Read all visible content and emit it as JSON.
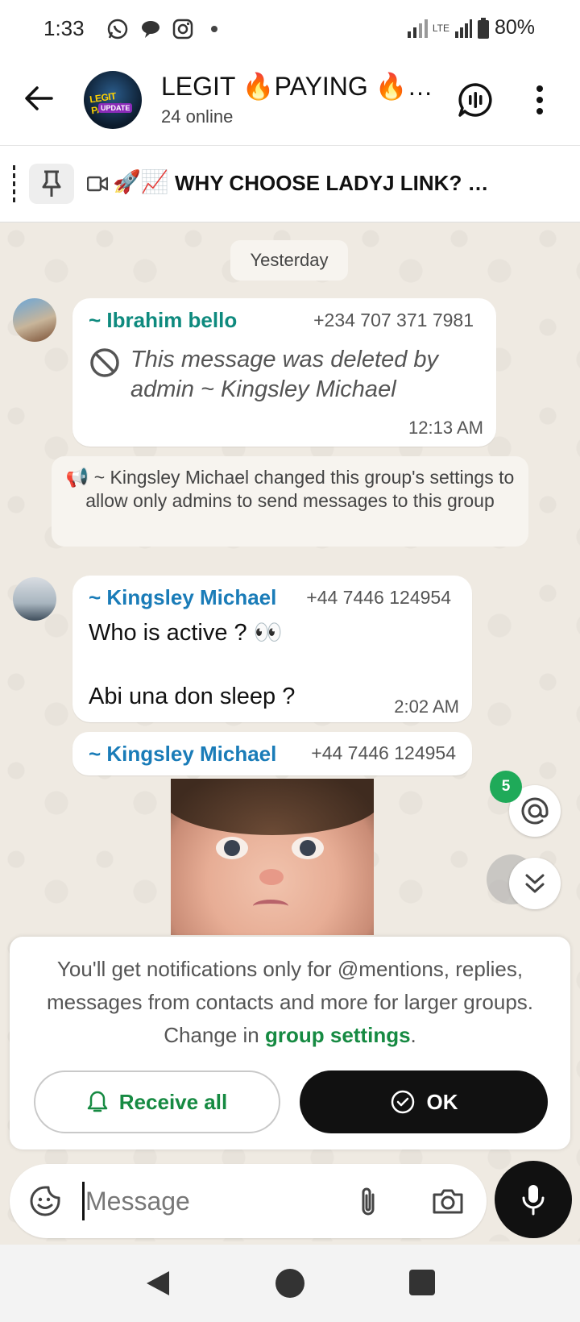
{
  "status_bar": {
    "time": "1:33",
    "network": "LTE",
    "battery": "80%",
    "notification_icons": [
      "whatsapp-icon",
      "chat-bubble-icon",
      "instagram-icon"
    ]
  },
  "header": {
    "avatar_text_1": "LEGIT PAYING",
    "avatar_text_2": "UPDATE",
    "title": "LEGIT 🔥PAYING 🔥…",
    "subtitle": "24 online"
  },
  "pinned": {
    "emoji": "🚀📈",
    "text": "WHY CHOOSE LADYJ LINK? …"
  },
  "chat": {
    "date_chip": "Yesterday",
    "messages": [
      {
        "sender": "~ Ibrahim bello",
        "phone": "+234 707 371 7981",
        "text": "This message was deleted by admin ~ Kingsley Michael",
        "time": "12:13 AM",
        "sender_color": "#0e8a7e"
      },
      {
        "type": "system",
        "text": "📢 ~ Kingsley Michael changed this group's settings to allow only admins to send messages to this group"
      },
      {
        "sender": "~ Kingsley Michael",
        "phone": "+44 7446 124954",
        "line1": "Who is active ? 👀",
        "line2": "Abi una don sleep ?",
        "time": "2:02 AM",
        "sender_color": "#1a7cb8"
      },
      {
        "sender": "~ Kingsley Michael",
        "phone": "+44 7446 124954",
        "image": "crying-baby-photo"
      }
    ],
    "mentions_count": "5"
  },
  "notice": {
    "text_before": "You'll get notifications only for @mentions, replies, messages from contacts and more for larger groups. Change in ",
    "link": "group settings",
    "text_after": ".",
    "receive_all_label": "Receive all",
    "ok_label": "OK"
  },
  "composer": {
    "placeholder": "Message"
  },
  "colors": {
    "accent_green": "#168a42",
    "badge_green": "#1faa59",
    "chat_bg": "#efeae2"
  }
}
